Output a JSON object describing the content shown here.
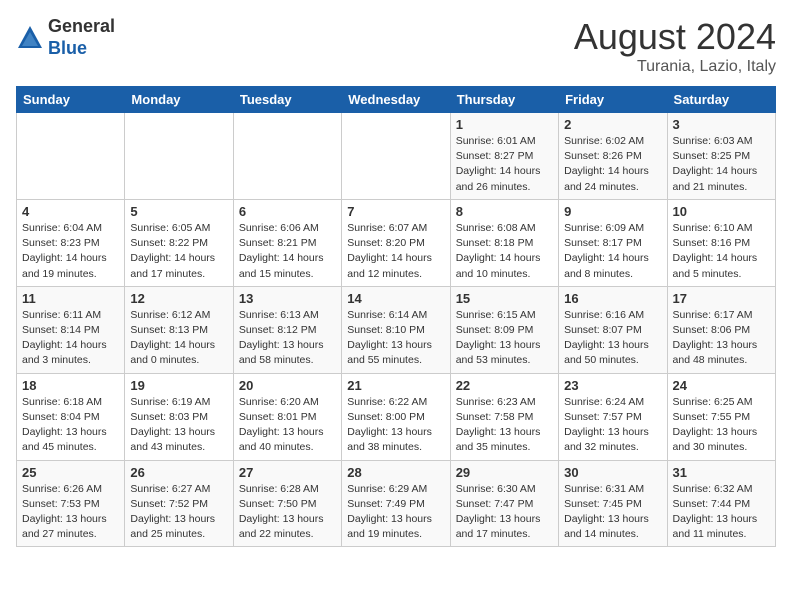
{
  "header": {
    "logo_general": "General",
    "logo_blue": "Blue",
    "month_title": "August 2024",
    "location": "Turania, Lazio, Italy"
  },
  "weekdays": [
    "Sunday",
    "Monday",
    "Tuesday",
    "Wednesday",
    "Thursday",
    "Friday",
    "Saturday"
  ],
  "weeks": [
    [
      {
        "day": "",
        "info": ""
      },
      {
        "day": "",
        "info": ""
      },
      {
        "day": "",
        "info": ""
      },
      {
        "day": "",
        "info": ""
      },
      {
        "day": "1",
        "info": "Sunrise: 6:01 AM\nSunset: 8:27 PM\nDaylight: 14 hours\nand 26 minutes."
      },
      {
        "day": "2",
        "info": "Sunrise: 6:02 AM\nSunset: 8:26 PM\nDaylight: 14 hours\nand 24 minutes."
      },
      {
        "day": "3",
        "info": "Sunrise: 6:03 AM\nSunset: 8:25 PM\nDaylight: 14 hours\nand 21 minutes."
      }
    ],
    [
      {
        "day": "4",
        "info": "Sunrise: 6:04 AM\nSunset: 8:23 PM\nDaylight: 14 hours\nand 19 minutes."
      },
      {
        "day": "5",
        "info": "Sunrise: 6:05 AM\nSunset: 8:22 PM\nDaylight: 14 hours\nand 17 minutes."
      },
      {
        "day": "6",
        "info": "Sunrise: 6:06 AM\nSunset: 8:21 PM\nDaylight: 14 hours\nand 15 minutes."
      },
      {
        "day": "7",
        "info": "Sunrise: 6:07 AM\nSunset: 8:20 PM\nDaylight: 14 hours\nand 12 minutes."
      },
      {
        "day": "8",
        "info": "Sunrise: 6:08 AM\nSunset: 8:18 PM\nDaylight: 14 hours\nand 10 minutes."
      },
      {
        "day": "9",
        "info": "Sunrise: 6:09 AM\nSunset: 8:17 PM\nDaylight: 14 hours\nand 8 minutes."
      },
      {
        "day": "10",
        "info": "Sunrise: 6:10 AM\nSunset: 8:16 PM\nDaylight: 14 hours\nand 5 minutes."
      }
    ],
    [
      {
        "day": "11",
        "info": "Sunrise: 6:11 AM\nSunset: 8:14 PM\nDaylight: 14 hours\nand 3 minutes."
      },
      {
        "day": "12",
        "info": "Sunrise: 6:12 AM\nSunset: 8:13 PM\nDaylight: 14 hours\nand 0 minutes."
      },
      {
        "day": "13",
        "info": "Sunrise: 6:13 AM\nSunset: 8:12 PM\nDaylight: 13 hours\nand 58 minutes."
      },
      {
        "day": "14",
        "info": "Sunrise: 6:14 AM\nSunset: 8:10 PM\nDaylight: 13 hours\nand 55 minutes."
      },
      {
        "day": "15",
        "info": "Sunrise: 6:15 AM\nSunset: 8:09 PM\nDaylight: 13 hours\nand 53 minutes."
      },
      {
        "day": "16",
        "info": "Sunrise: 6:16 AM\nSunset: 8:07 PM\nDaylight: 13 hours\nand 50 minutes."
      },
      {
        "day": "17",
        "info": "Sunrise: 6:17 AM\nSunset: 8:06 PM\nDaylight: 13 hours\nand 48 minutes."
      }
    ],
    [
      {
        "day": "18",
        "info": "Sunrise: 6:18 AM\nSunset: 8:04 PM\nDaylight: 13 hours\nand 45 minutes."
      },
      {
        "day": "19",
        "info": "Sunrise: 6:19 AM\nSunset: 8:03 PM\nDaylight: 13 hours\nand 43 minutes."
      },
      {
        "day": "20",
        "info": "Sunrise: 6:20 AM\nSunset: 8:01 PM\nDaylight: 13 hours\nand 40 minutes."
      },
      {
        "day": "21",
        "info": "Sunrise: 6:22 AM\nSunset: 8:00 PM\nDaylight: 13 hours\nand 38 minutes."
      },
      {
        "day": "22",
        "info": "Sunrise: 6:23 AM\nSunset: 7:58 PM\nDaylight: 13 hours\nand 35 minutes."
      },
      {
        "day": "23",
        "info": "Sunrise: 6:24 AM\nSunset: 7:57 PM\nDaylight: 13 hours\nand 32 minutes."
      },
      {
        "day": "24",
        "info": "Sunrise: 6:25 AM\nSunset: 7:55 PM\nDaylight: 13 hours\nand 30 minutes."
      }
    ],
    [
      {
        "day": "25",
        "info": "Sunrise: 6:26 AM\nSunset: 7:53 PM\nDaylight: 13 hours\nand 27 minutes."
      },
      {
        "day": "26",
        "info": "Sunrise: 6:27 AM\nSunset: 7:52 PM\nDaylight: 13 hours\nand 25 minutes."
      },
      {
        "day": "27",
        "info": "Sunrise: 6:28 AM\nSunset: 7:50 PM\nDaylight: 13 hours\nand 22 minutes."
      },
      {
        "day": "28",
        "info": "Sunrise: 6:29 AM\nSunset: 7:49 PM\nDaylight: 13 hours\nand 19 minutes."
      },
      {
        "day": "29",
        "info": "Sunrise: 6:30 AM\nSunset: 7:47 PM\nDaylight: 13 hours\nand 17 minutes."
      },
      {
        "day": "30",
        "info": "Sunrise: 6:31 AM\nSunset: 7:45 PM\nDaylight: 13 hours\nand 14 minutes."
      },
      {
        "day": "31",
        "info": "Sunrise: 6:32 AM\nSunset: 7:44 PM\nDaylight: 13 hours\nand 11 minutes."
      }
    ]
  ]
}
